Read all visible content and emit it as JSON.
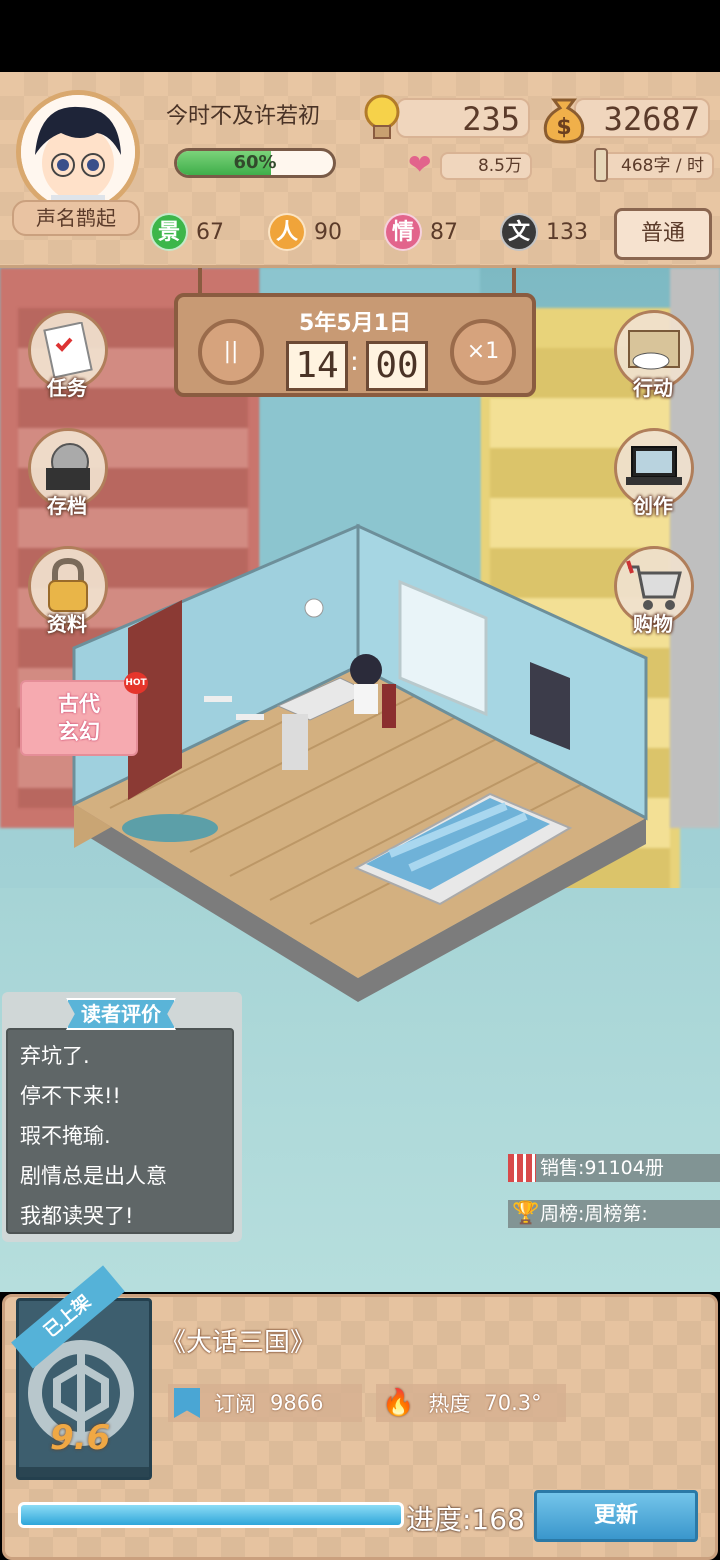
{
  "header": {
    "username": "今时不及许若初",
    "title_badge": "声名鹊起",
    "progress_text": "60%",
    "progress_value": 0.6,
    "inspiration": "235",
    "money": "32687",
    "fans": "8.5万",
    "speed": "468字 / 时",
    "mode_button": "普通",
    "attributes": [
      {
        "char": "景",
        "value": "67",
        "color": "#3cb64a"
      },
      {
        "char": "人",
        "value": "90",
        "color": "#f0a43a"
      },
      {
        "char": "情",
        "value": "87",
        "color": "#e2648c"
      },
      {
        "char": "文",
        "value": "133",
        "color": "#3a3a3a"
      }
    ]
  },
  "clock": {
    "date": "5年5月1日",
    "hour": "14",
    "minute": "00",
    "pause_label": "||",
    "speed_label": "×1"
  },
  "side_left": [
    {
      "label": "任务"
    },
    {
      "label": "存档"
    },
    {
      "label": "资料"
    }
  ],
  "side_right": [
    {
      "label": "行动"
    },
    {
      "label": "创作"
    },
    {
      "label": "购物"
    }
  ],
  "genre": {
    "line1": "古代",
    "line2": "玄幻",
    "hot": "HOT"
  },
  "reviews": {
    "title": "读者评价",
    "items": [
      "弃坑了.",
      "停不下来!!",
      "瑕不掩瑜.",
      "剧情总是出人意",
      "我都读哭了!"
    ]
  },
  "sales": {
    "text": "销售:91104册"
  },
  "weekly": {
    "text": "周榜:周榜第:"
  },
  "book": {
    "shelf_tag": "已上架",
    "score": "9.6",
    "title": "《大话三国》",
    "subscribe_label": "订阅",
    "subscribe_value": "9866",
    "heat_label": "热度",
    "heat_value": "70.3°",
    "progress_text": "进度:168",
    "update_button": "更新"
  },
  "colors": {
    "accent_blue": "#3aa4d8",
    "panel_tan": "#e8c6a3",
    "progress_green": "#3fae4a"
  }
}
